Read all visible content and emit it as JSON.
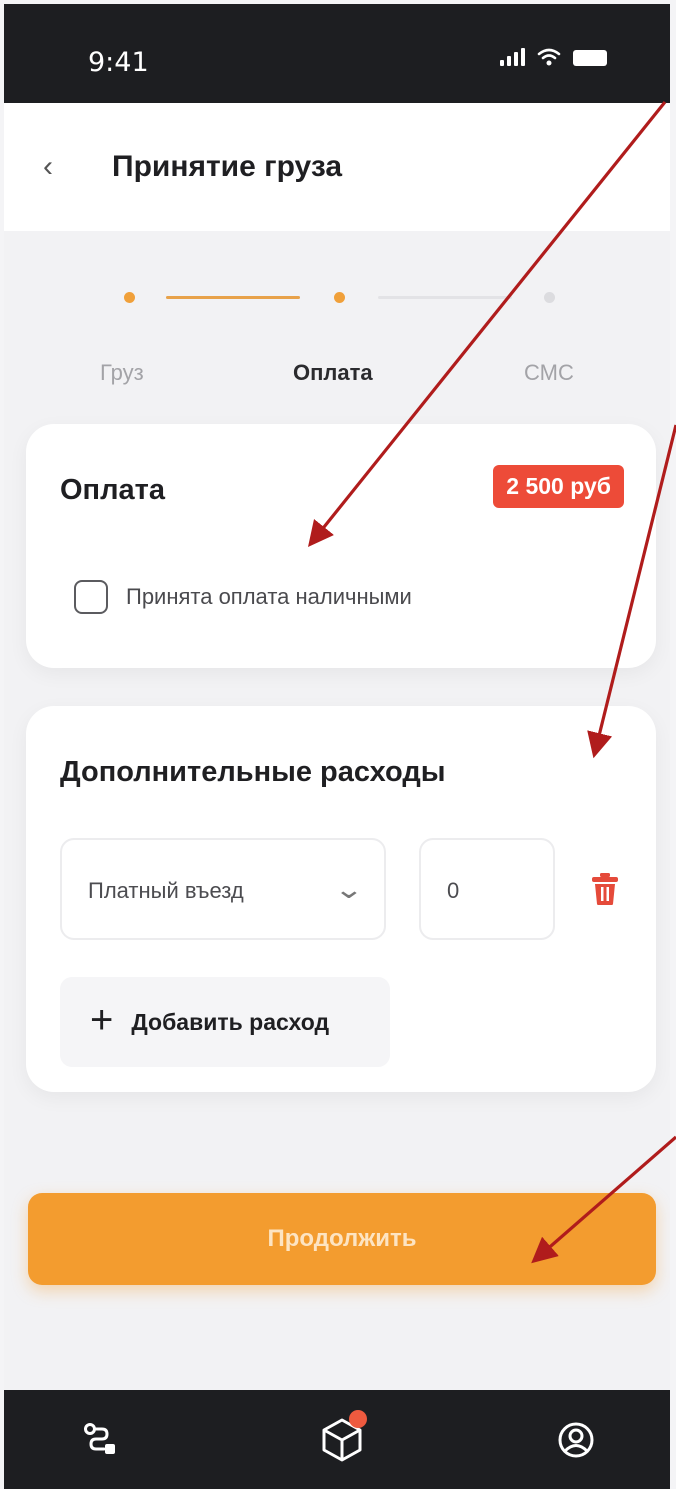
{
  "status_bar": {
    "time": "9:41",
    "icons": [
      "signal-icon",
      "wifi-icon",
      "battery-icon"
    ]
  },
  "header": {
    "back_icon": "chevron-left-icon",
    "title": "Принятие груза"
  },
  "stepper": {
    "steps": [
      {
        "label": "Груз",
        "state": "done"
      },
      {
        "label": "Оплата",
        "state": "active"
      },
      {
        "label": "СМС",
        "state": "pending"
      }
    ]
  },
  "payment_card": {
    "title": "Оплата",
    "price": "2 500 руб",
    "checkbox_label": "Принята оплата наличными",
    "checkbox_checked": false
  },
  "expenses_card": {
    "title": "Дополнительные расходы",
    "expense_type": "Платный въезд",
    "expense_amount": "0",
    "delete_icon": "trash-icon",
    "add_button_label": "Добавить расход"
  },
  "continue_button": {
    "label": "Продолжить"
  },
  "tab_bar": {
    "items": [
      "route-icon",
      "package-icon",
      "profile-icon"
    ],
    "package_has_badge": true
  },
  "colors": {
    "accent": "#f39c2f",
    "badge_red": "#ed4b38",
    "dark_bar": "#1d1e21",
    "annotation_arrow": "#b01c1c"
  }
}
